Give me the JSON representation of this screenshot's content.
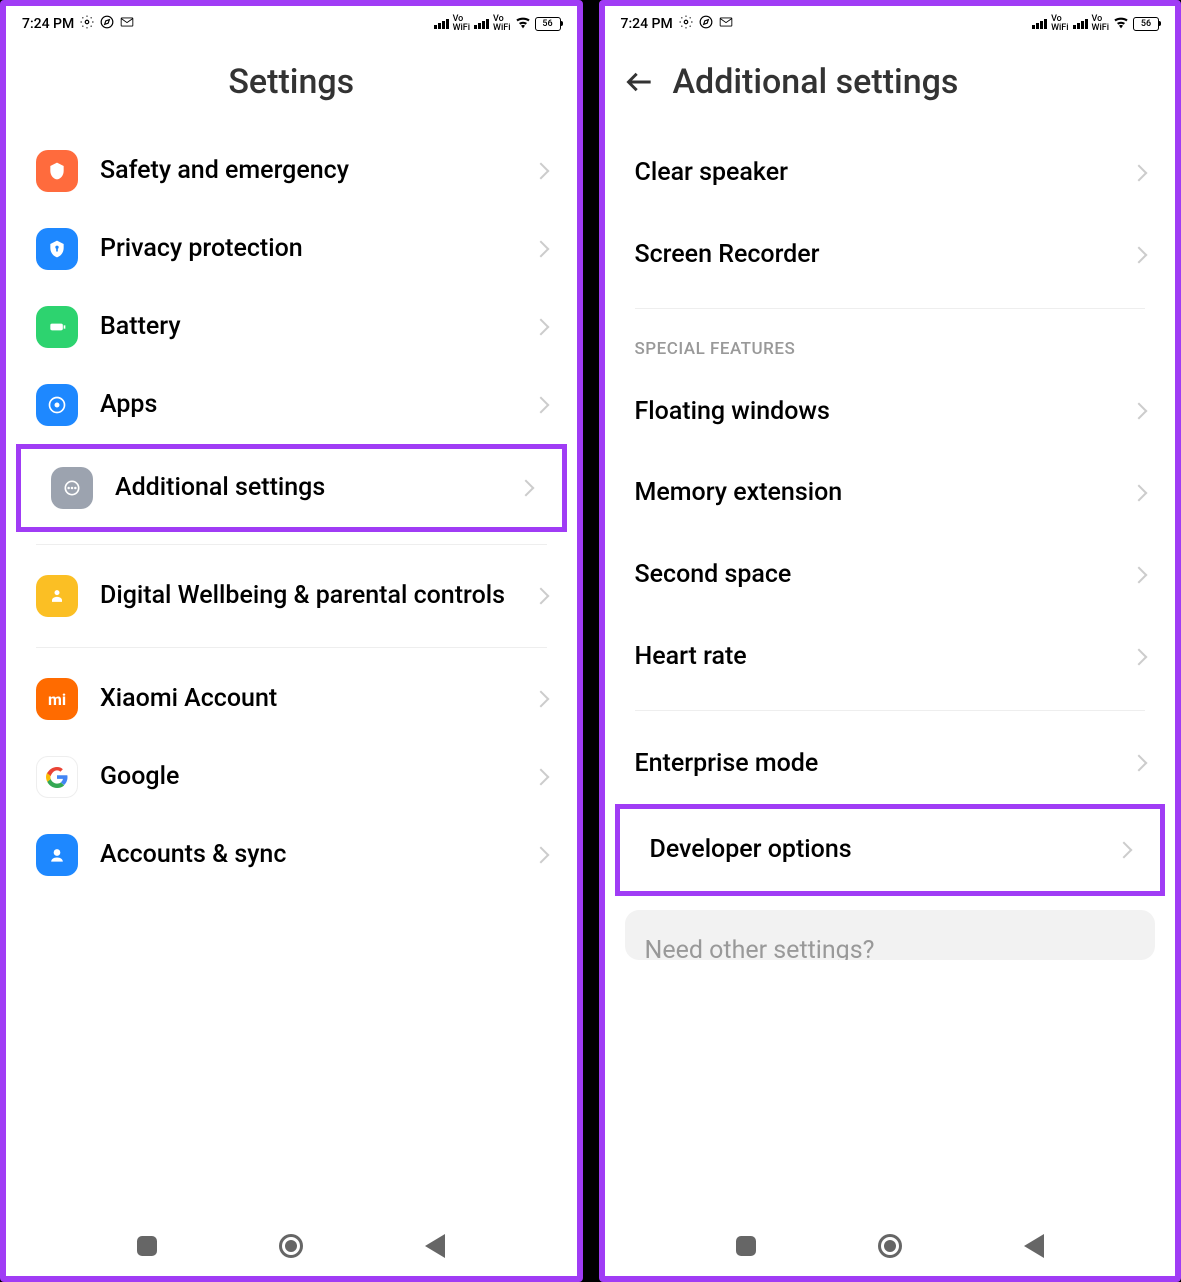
{
  "status": {
    "time": "7:24 PM",
    "battery": "56"
  },
  "left": {
    "title": "Settings",
    "items": [
      {
        "label": "Safety and emergency",
        "icon": "safety"
      },
      {
        "label": "Privacy protection",
        "icon": "privacy"
      },
      {
        "label": "Battery",
        "icon": "battery"
      },
      {
        "label": "Apps",
        "icon": "apps"
      },
      {
        "label": "Additional settings",
        "icon": "additional",
        "highlighted": true
      },
      {
        "label": "Digital Wellbeing & parental controls",
        "icon": "wellbeing"
      },
      {
        "label": "Xiaomi Account",
        "icon": "xiaomi"
      },
      {
        "label": "Google",
        "icon": "google"
      },
      {
        "label": "Accounts & sync",
        "icon": "accounts"
      }
    ]
  },
  "right": {
    "title": "Additional settings",
    "top_items": [
      {
        "label": "Clear speaker"
      },
      {
        "label": "Screen Recorder"
      }
    ],
    "section_header": "SPECIAL FEATURES",
    "special_features": [
      {
        "label": "Floating windows"
      },
      {
        "label": "Memory extension"
      },
      {
        "label": "Second space"
      },
      {
        "label": "Heart rate"
      }
    ],
    "bottom_items": [
      {
        "label": "Enterprise mode"
      },
      {
        "label": "Developer options",
        "highlighted": true
      }
    ],
    "search_hint": "Need other settings?"
  }
}
